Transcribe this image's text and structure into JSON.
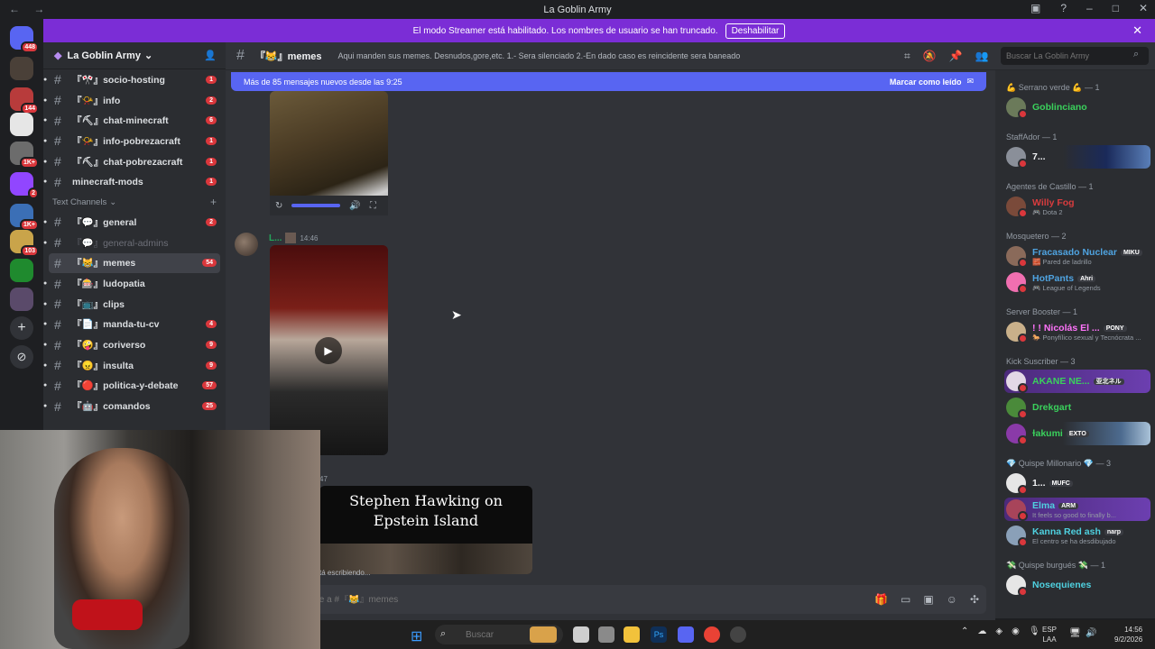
{
  "window": {
    "title": "La Goblin Army"
  },
  "banner": {
    "text": "El modo Streamer está habilitado. Los nombres de usuario se han truncado.",
    "button": "Deshabilitar"
  },
  "server": {
    "name": "La Goblin Army",
    "rail_badges": [
      "448",
      "144",
      "1K+",
      "1K+",
      "2",
      "1K+",
      "103"
    ]
  },
  "channels": [
    {
      "name": "『🎌』socio-hosting",
      "count": "1",
      "muted": false
    },
    {
      "name": "『📯』info",
      "count": "2",
      "muted": false
    },
    {
      "name": "『⛏』chat-minecraft",
      "count": "6",
      "muted": false
    },
    {
      "name": "『📯』info-pobrezacraft",
      "count": "1",
      "muted": false
    },
    {
      "name": "『⛏』chat-pobrezacraft",
      "count": "1",
      "muted": false
    },
    {
      "name": "minecraft-mods",
      "count": "1",
      "muted": false
    }
  ],
  "text_category": "Text Channels",
  "text_channels": [
    {
      "name": "『💬』general",
      "count": "2",
      "muted": false,
      "active": false
    },
    {
      "name": "『💬』general-admins",
      "count": "",
      "muted": true,
      "active": false
    },
    {
      "name": "『😹』memes",
      "count": "54",
      "muted": false,
      "active": true
    },
    {
      "name": "『🎰』ludopatia",
      "count": "",
      "muted": false,
      "active": false
    },
    {
      "name": "『📺』clips",
      "count": "",
      "muted": false,
      "active": false
    },
    {
      "name": "『📄』manda-tu-cv",
      "count": "4",
      "muted": false,
      "active": false
    },
    {
      "name": "『🤪』coriverso",
      "count": "9",
      "muted": false,
      "active": false
    },
    {
      "name": "『😠』insulta",
      "count": "9",
      "muted": false,
      "active": false
    },
    {
      "name": "『🔴』politica-y-debate",
      "count": "57",
      "muted": false,
      "active": false
    },
    {
      "name": "『🤖』comandos",
      "count": "25",
      "muted": false,
      "active": false
    }
  ],
  "header": {
    "channel": "『😹』memes",
    "topic": "Aqui manden sus memes. Desnudos,gore,etc. 1.- Sera silenciado 2.-En dado caso es reincidente sera baneado",
    "search_placeholder": "Buscar La Goblin Army"
  },
  "chat": {
    "new_messages": "Más de 85 mensajes nuevos desde las 9:25",
    "mark_read": "Marcar como leído",
    "msg_user": "L...",
    "msg_time": "14:46",
    "second_time": "47",
    "preview_title_1": "Stephen Hawking on",
    "preview_title_2": "Epstein Island",
    "typing": "tá escribiendo...",
    "composer_placeholder": "aje a #『😹』memes"
  },
  "members": [
    {
      "role": "💪 Serrano verde 💪 — 1"
    },
    {
      "name": "Goblinciano",
      "color": "#3ad15c"
    },
    {
      "role": "StaffAdor — 1"
    },
    {
      "name": "7...",
      "color": "#f2f3f5"
    },
    {
      "role": "Agentes de Castillo — 1"
    },
    {
      "name": "Willy Fog",
      "color": "#d83c3e",
      "status": "🎮 Dota 2"
    },
    {
      "role": "Mosquetero — 2"
    },
    {
      "name": "Fracasado Nuclear",
      "color": "#4fa3e0",
      "tag": "MIKU",
      "status": "🧱 Pared de ladrillo"
    },
    {
      "name": "HotPants",
      "color": "#4fa3e0",
      "tag": "Ahri",
      "status": "🎮 League of Legends"
    },
    {
      "role": "Server Booster — 1"
    },
    {
      "name": "! ! Nicolás El ...",
      "color": "#ff73fa",
      "tag": "PONY",
      "status": "🐎 Ponyfílico sexual y Tecnócrata ..."
    },
    {
      "role": "Kick Suscriber — 3"
    },
    {
      "name": "AKANE NE...",
      "color": "#3ad15c",
      "tag": "亚北ネル"
    },
    {
      "name": "Drekgart",
      "color": "#3ad15c"
    },
    {
      "name": "ɫakumi",
      "color": "#3ad15c",
      "tag": "EXTO"
    },
    {
      "role": "💎 Quispe Millonario 💎 — 3"
    },
    {
      "name": "1...",
      "color": "#f2f3f5",
      "tag": "MUFC"
    },
    {
      "name": "Elma",
      "color": "#4fd1e0",
      "tag": "ARM",
      "status": "It feels so good to finally b..."
    },
    {
      "name": "Kanna Red ash",
      "color": "#4fd1e0",
      "tag": "narp",
      "status": "El centro se ha desdibujado"
    },
    {
      "role": "💸 Quispe burgués 💸 — 1"
    },
    {
      "name": "Nosequienes",
      "color": "#4fd1e0"
    }
  ],
  "taskbar": {
    "search": "Buscar",
    "lang_1": "ESP",
    "lang_2": "LAA",
    "time": "14:56",
    "date": "9/2/2026"
  }
}
